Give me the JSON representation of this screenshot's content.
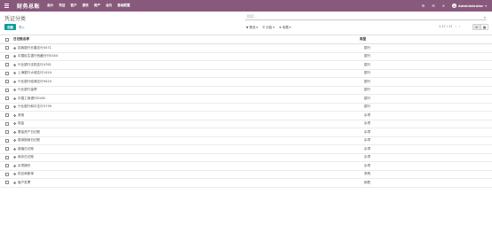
{
  "app": {
    "brand": "财务总账",
    "menu": [
      "会计",
      "凭证",
      "客户",
      "报表",
      "资产",
      "合约",
      "基础配置"
    ],
    "icons": [
      "bug-icon",
      "chat-icon",
      "close-icon"
    ],
    "user": "Administrator",
    "user_initial": "A"
  },
  "page": {
    "title": "凭证分类",
    "search_placeholder": "搜索...",
    "create_label": "创建",
    "import_label": "导入",
    "filter_label": "▼ 筛选 ▾",
    "group_label": "☰ 分组 ▾",
    "favorite_label": "★ 收藏 ▾",
    "pager_text": "1-17 / 17",
    "pager_prev": "‹",
    "pager_next": "›"
  },
  "table": {
    "headers": {
      "name": "日记账名称",
      "type": "类型"
    },
    "rows": [
      {
        "name": "招商银行长春支行0471",
        "type": "银行"
      },
      {
        "name": "中国民生银行西藏分行0344",
        "type": "银行"
      },
      {
        "name": "兴业银行沈阳支行4761",
        "type": "银行"
      },
      {
        "name": "上海银行大城支行1424",
        "type": "银行"
      },
      {
        "name": "兴业银行临港支行9425",
        "type": "银行"
      },
      {
        "name": "兴业银行金帮",
        "type": "银行"
      },
      {
        "name": "中国工商银行6106",
        "type": "银行"
      },
      {
        "name": "兴业银行和平支行5739",
        "type": "银行"
      },
      {
        "name": "其他",
        "type": "杂项"
      },
      {
        "name": "现金",
        "type": "杂项"
      },
      {
        "name": "基金资产日记账",
        "type": "杂项"
      },
      {
        "name": "费用报销日记账",
        "type": "杂项"
      },
      {
        "name": "增值日记账",
        "type": "杂项"
      },
      {
        "name": "库存日记账",
        "type": "杂项"
      },
      {
        "name": "杂项操作",
        "type": "杂项"
      },
      {
        "name": "供应商账单",
        "type": "采购"
      },
      {
        "name": "客户发票",
        "type": "销售"
      }
    ]
  }
}
